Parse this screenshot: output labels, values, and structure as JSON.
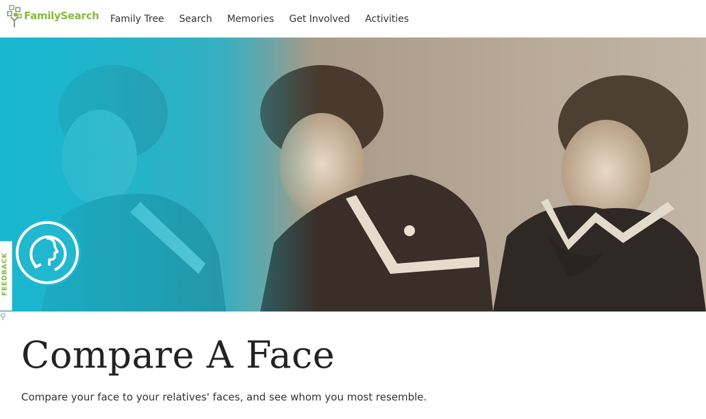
{
  "header": {
    "brand": "FamilySearch",
    "nav": [
      "Family Tree",
      "Search",
      "Memories",
      "Get Involved",
      "Activities"
    ]
  },
  "hero": {
    "badge_icon": "compare-face-icon"
  },
  "feedback": {
    "label": "FEEDBACK"
  },
  "main": {
    "title": "Compare A Face",
    "subtitle": "Compare your face to your relatives' faces, and see whom you most resemble."
  },
  "colors": {
    "brand_green": "#87b940",
    "teal": "#21b8cf"
  }
}
